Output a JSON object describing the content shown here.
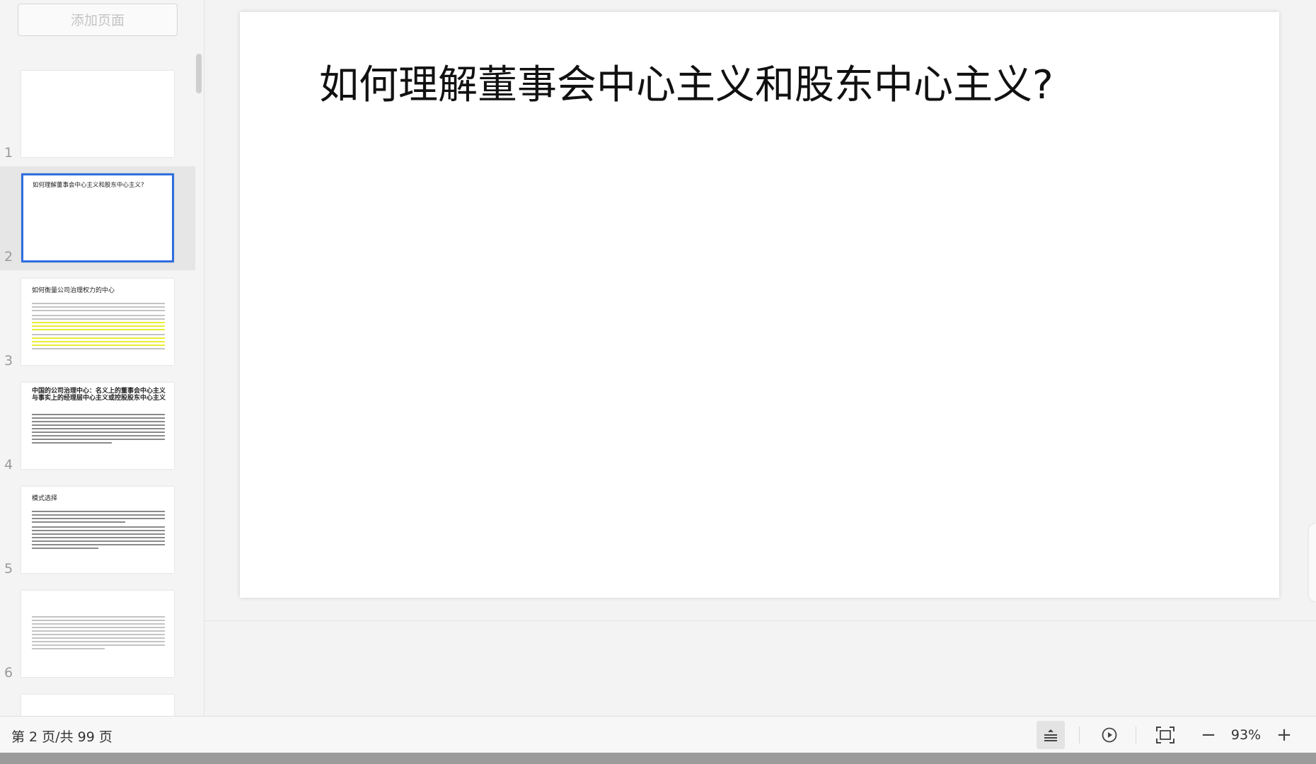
{
  "sidebar": {
    "add_page_label": "添加页面",
    "thumbnails": [
      {
        "number": "1",
        "title": ""
      },
      {
        "number": "2",
        "title": "如何理解董事会中心主义和股东中心主义?"
      },
      {
        "number": "3",
        "title": "如何衡量公司治理权力的中心"
      },
      {
        "number": "4",
        "title": "中国的公司治理中心：名义上的董事会中心主义与事实上的经理层中心主义或控股股东中心主义"
      },
      {
        "number": "5",
        "title": "模式选择"
      },
      {
        "number": "6",
        "title": ""
      }
    ]
  },
  "slide": {
    "title": "如何理解董事会中心主义和股东中心主义?"
  },
  "statusbar": {
    "page_indicator": "第 2 页/共 99 页",
    "zoom_level": "93%",
    "zoom_out": "−",
    "zoom_in": "+"
  },
  "colors": {
    "selected_border": "#2f6fe0",
    "highlight": "#e9ee33"
  }
}
